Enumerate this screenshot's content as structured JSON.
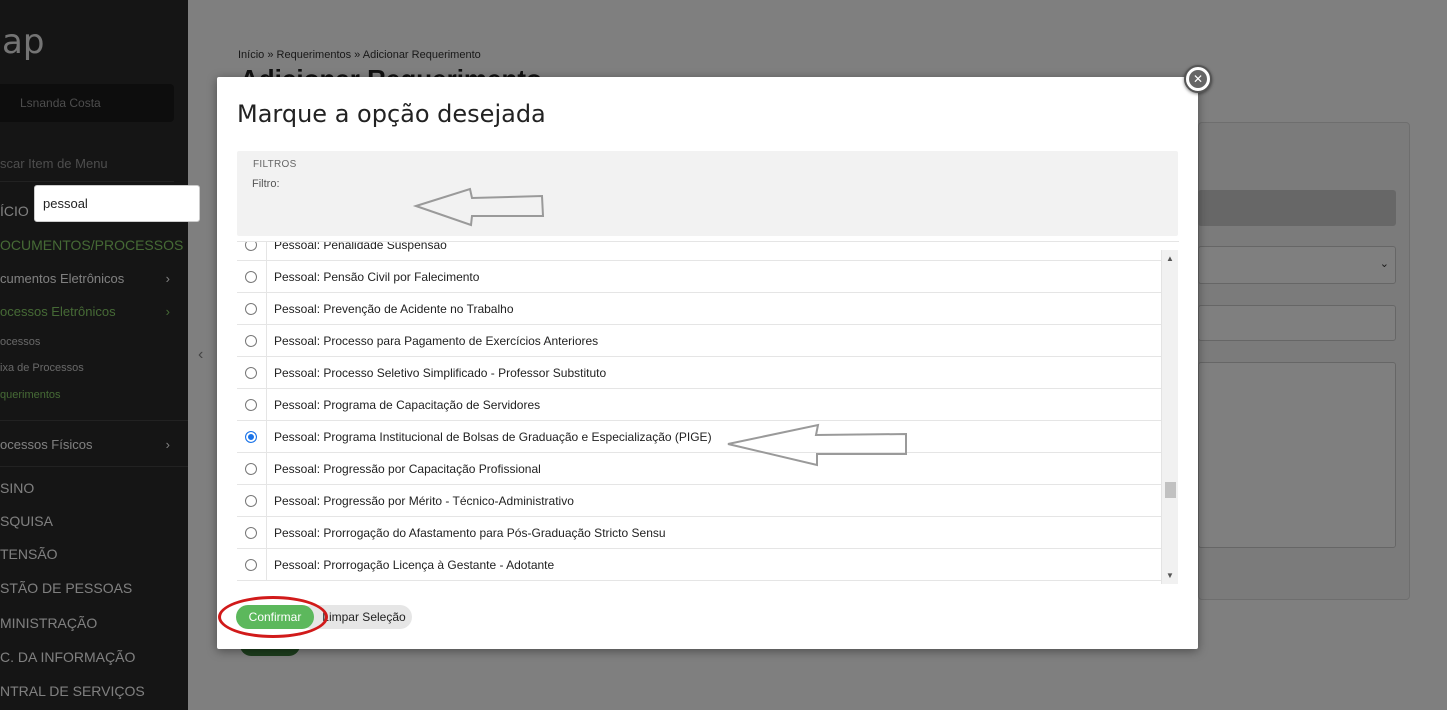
{
  "sidebar": {
    "logo": "ap",
    "user": "Lsnanda Costa",
    "search_placeholder": "scar Item de Menu",
    "items": [
      {
        "label": "ÍCIO"
      },
      {
        "label": "OCUMENTOS/PROCESSOS"
      },
      {
        "label": "cumentos Eletrônicos"
      },
      {
        "label": "ocessos Eletrônicos"
      },
      {
        "label": "ocessos"
      },
      {
        "label": "ixa de Processos"
      },
      {
        "label": "querimentos"
      },
      {
        "label": "ocessos Físicos"
      },
      {
        "label": "SINO"
      },
      {
        "label": "SQUISA"
      },
      {
        "label": "TENSÃO"
      },
      {
        "label": "STÃO DE PESSOAS"
      },
      {
        "label": "MINISTRAÇÃO"
      },
      {
        "label": "C. DA INFORMAÇÃO"
      },
      {
        "label": "NTRAL DE SERVIÇOS"
      }
    ]
  },
  "page": {
    "breadcrumb": "Início » Requerimentos » Adicionar Requerimento",
    "title": "Adicionar Requerimento"
  },
  "modal": {
    "title": "Marque a opção desejada",
    "filters_legend": "FILTROS",
    "filter_label": "Filtro:",
    "filter_value": "pessoal",
    "options": [
      {
        "label": "Pessoal: Penalidade Suspensão",
        "selected": false
      },
      {
        "label": "Pessoal: Pensão Civil por Falecimento",
        "selected": false
      },
      {
        "label": "Pessoal: Prevenção de Acidente no Trabalho",
        "selected": false
      },
      {
        "label": "Pessoal: Processo para Pagamento de Exercícios Anteriores",
        "selected": false
      },
      {
        "label": "Pessoal: Processo Seletivo Simplificado - Professor Substituto",
        "selected": false
      },
      {
        "label": "Pessoal: Programa de Capacitação de Servidores",
        "selected": false
      },
      {
        "label": "Pessoal: Programa Institucional de Bolsas de Graduação e Especialização (PIGE)",
        "selected": true
      },
      {
        "label": "Pessoal: Progressão por Capacitação Profissional",
        "selected": false
      },
      {
        "label": "Pessoal: Progressão por Mérito - Técnico-Administrativo",
        "selected": false
      },
      {
        "label": "Pessoal: Prorrogação do Afastamento para Pós-Graduação Stricto Sensu",
        "selected": false
      },
      {
        "label": "Pessoal: Prorrogação Licença à Gestante - Adotante",
        "selected": false
      }
    ],
    "confirm_label": "Confirmar",
    "clear_label": "Limpar Seleção",
    "close_symbol": "✕"
  },
  "icons": {
    "chevron_right": "›",
    "chevron_left": "‹",
    "chevron_down": "⌄",
    "scroll_up": "▲",
    "scroll_down": "▼"
  },
  "colors": {
    "accent_green": "#5cb85c",
    "annotation_red": "#d11a1a",
    "sidebar_bg": "#2b2b2b",
    "radio_selected": "#1a73e8"
  }
}
